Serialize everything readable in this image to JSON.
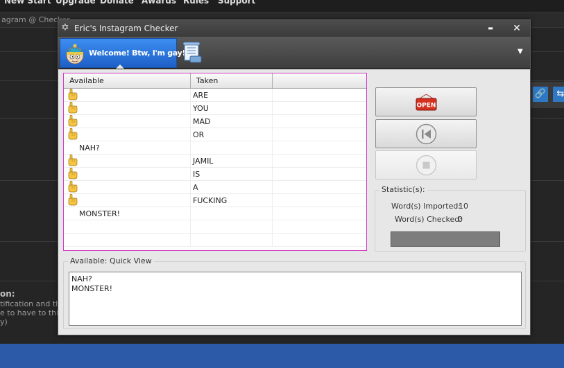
{
  "background": {
    "topnav": [
      "New Start",
      "Upgrade",
      "Donate",
      "Awards",
      "Rules",
      "Support"
    ],
    "crumb": "agram @ Checker",
    "side_label": "on:",
    "side_lines": [
      "tification and thr",
      "e to have to this t",
      "y)"
    ]
  },
  "window": {
    "title": "Eric's Instagram Checker",
    "title_icon": "star-of-david-icon",
    "minimize_glyph": "▬",
    "close_glyph": "✕",
    "tab_label": "Welcome! Btw, I'm gay!",
    "dropdown_glyph": "▼"
  },
  "list": {
    "columns": [
      "Available",
      "Taken",
      ""
    ],
    "rows": [
      {
        "hand": true,
        "available": "",
        "taken": "ARE"
      },
      {
        "hand": true,
        "available": "",
        "taken": "YOU"
      },
      {
        "hand": true,
        "available": "",
        "taken": "MAD"
      },
      {
        "hand": true,
        "available": "",
        "taken": "OR"
      },
      {
        "hand": false,
        "available": "NAH?",
        "taken": ""
      },
      {
        "hand": true,
        "available": "",
        "taken": "JAMIL"
      },
      {
        "hand": true,
        "available": "",
        "taken": "IS"
      },
      {
        "hand": true,
        "available": "",
        "taken": "A"
      },
      {
        "hand": true,
        "available": "",
        "taken": "FUCKING"
      },
      {
        "hand": false,
        "available": "MONSTER!",
        "taken": ""
      },
      {
        "hand": false,
        "available": "",
        "taken": ""
      },
      {
        "hand": false,
        "available": "",
        "taken": ""
      }
    ]
  },
  "buttons": {
    "open_sign": "OPEN"
  },
  "stats": {
    "title": "Statistic(s):",
    "imported_label": "Word(s) Imported:",
    "imported_value": "10",
    "checked_label": "Word(s) Checked:",
    "checked_value": "0",
    "progress": 0
  },
  "quick_view": {
    "title": "Available: Quick View",
    "text": "NAH?\nMONSTER!"
  },
  "colors": {
    "list_border": "#d33ac6",
    "tab_active": "#2a74de",
    "progress_fill": "#7d7d7d"
  }
}
